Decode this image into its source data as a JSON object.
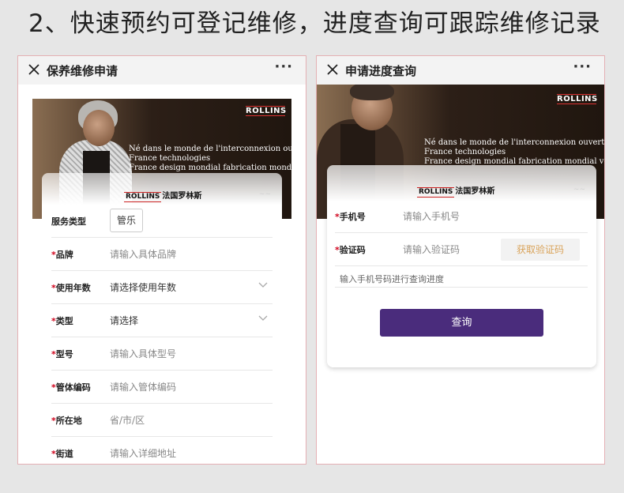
{
  "headline": "2、快速预约可登记维修，进度查询可跟踪维修记录",
  "brand": {
    "logo_text": "ROLLINS",
    "logo_cn": "法国罗林斯",
    "tagline": [
      "Né dans le monde de l'interconnexion ouverte",
      "France technologies",
      "France design mondial fabrication mondial vente"
    ]
  },
  "left_screen": {
    "title": "保养维修申请",
    "more": "···",
    "fields": [
      {
        "label": "服务类型",
        "required": "",
        "value": "管乐"
      },
      {
        "label": "品牌",
        "required": "*",
        "placeholder": "请输入具体品牌"
      },
      {
        "label": "使用年数",
        "required": "*",
        "value": "请选择使用年数"
      },
      {
        "label": "类型",
        "required": "*",
        "value": "请选择"
      },
      {
        "label": "型号",
        "required": "*",
        "placeholder": "请输入具体型号"
      },
      {
        "label": "管体编码",
        "required": "*",
        "placeholder": "请输入管体编码"
      },
      {
        "label": "所在地",
        "required": "*",
        "placeholder": "省/市/区"
      },
      {
        "label": "街道",
        "required": "*",
        "placeholder": "请输入详细地址"
      }
    ]
  },
  "right_screen": {
    "title": "申请进度查询",
    "more": "···",
    "phone": {
      "label": "手机号",
      "required": "*",
      "placeholder": "请输入手机号"
    },
    "code": {
      "label": "验证码",
      "required": "*",
      "placeholder": "请输入验证码",
      "button": "获取验证码"
    },
    "hint": "输入手机号码进行查询进度",
    "query_button": "查询"
  },
  "colors": {
    "accent_purple": "#4a2c7c",
    "required_red": "#d0021b",
    "code_button_text": "#d9a35a"
  }
}
